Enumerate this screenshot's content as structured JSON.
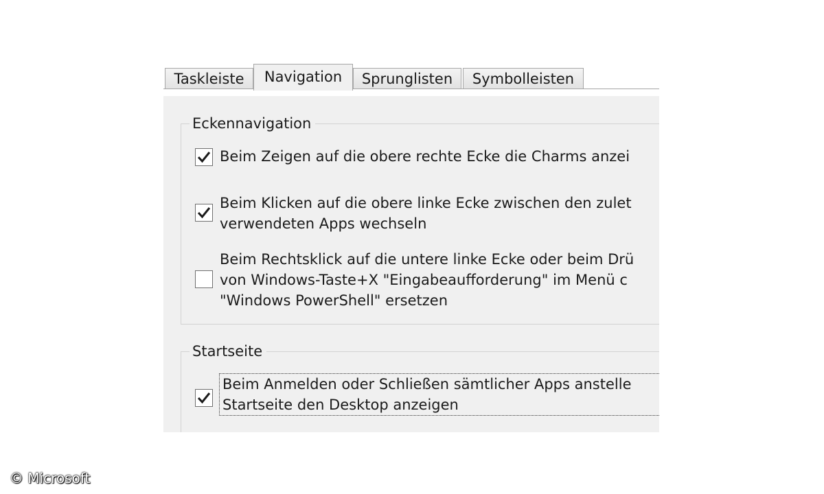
{
  "tabs": [
    {
      "label": "Taskleiste",
      "active": false
    },
    {
      "label": "Navigation",
      "active": true
    },
    {
      "label": "Sprunglisten",
      "active": false
    },
    {
      "label": "Symbolleisten",
      "active": false
    }
  ],
  "corner_navigation": {
    "legend": "Eckennavigation",
    "options": [
      {
        "checked": true,
        "lines": [
          "Beim Zeigen auf die obere rechte Ecke die Charms anzei"
        ]
      },
      {
        "checked": true,
        "lines": [
          "Beim Klicken auf die obere linke Ecke zwischen den zulet",
          "verwendeten Apps wechseln"
        ]
      },
      {
        "checked": false,
        "lines": [
          "Beim Rechtsklick auf die untere linke Ecke oder beim Drü",
          "von Windows-Taste+X \"Eingabeaufforderung\" im Menü c",
          "\"Windows PowerShell\" ersetzen"
        ]
      }
    ]
  },
  "start_page": {
    "legend": "Startseite",
    "options": [
      {
        "checked": true,
        "lines": [
          "Beim Anmelden oder Schließen sämtlicher Apps anstelle",
          "Startseite den Desktop anzeigen"
        ]
      }
    ]
  },
  "copyright": "© Microsoft",
  "icons": {
    "checkmark": "checkmark-icon"
  }
}
